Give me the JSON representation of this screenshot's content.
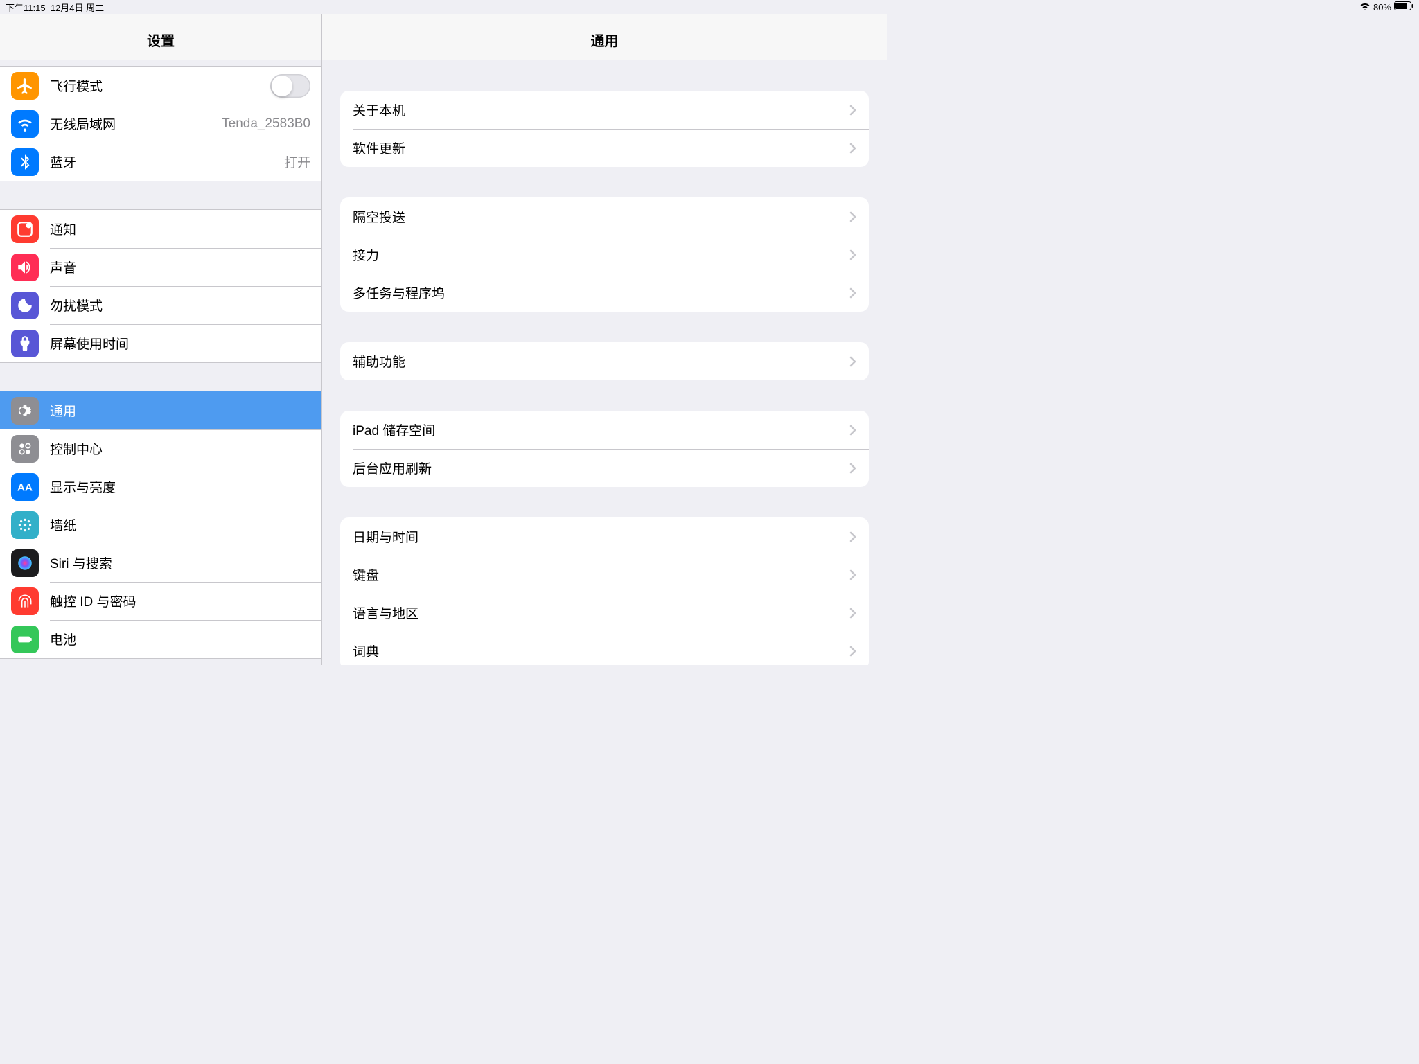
{
  "status": {
    "time": "下午11:15",
    "date": "12月4日 周二",
    "battery": "80%"
  },
  "sidebar": {
    "title": "设置",
    "g1": [
      {
        "label": "飞行模式",
        "icon": "airplane",
        "bg": "#ff9500"
      },
      {
        "label": "无线局域网",
        "value": "Tenda_2583B0",
        "icon": "wifi",
        "bg": "#007aff"
      },
      {
        "label": "蓝牙",
        "value": "打开",
        "icon": "bluetooth",
        "bg": "#007aff"
      }
    ],
    "g2": [
      {
        "label": "通知",
        "icon": "notify",
        "bg": "#ff3b30"
      },
      {
        "label": "声音",
        "icon": "sound",
        "bg": "#ff2d55"
      },
      {
        "label": "勿扰模式",
        "icon": "dnd",
        "bg": "#5856d6"
      },
      {
        "label": "屏幕使用时间",
        "icon": "screentime",
        "bg": "#5856d6"
      }
    ],
    "g3": [
      {
        "label": "通用",
        "icon": "gear",
        "bg": "#8e8e93",
        "selected": true
      },
      {
        "label": "控制中心",
        "icon": "control",
        "bg": "#8e8e93"
      },
      {
        "label": "显示与亮度",
        "icon": "display",
        "bg": "#007aff"
      },
      {
        "label": "墙纸",
        "icon": "wallpaper",
        "bg": "#32b0c9"
      },
      {
        "label": "Siri 与搜索",
        "icon": "siri",
        "bg": "#1c1c1e"
      },
      {
        "label": "触控 ID 与密码",
        "icon": "touchid",
        "bg": "#ff3b30"
      },
      {
        "label": "电池",
        "icon": "battery",
        "bg": "#34c759"
      }
    ]
  },
  "detail": {
    "title": "通用",
    "sections": [
      [
        "关于本机",
        "软件更新"
      ],
      [
        "隔空投送",
        "接力",
        "多任务与程序坞"
      ],
      [
        "辅助功能"
      ],
      [
        "iPad 储存空间",
        "后台应用刷新"
      ],
      [
        "日期与时间",
        "键盘",
        "语言与地区",
        "词典"
      ]
    ]
  }
}
